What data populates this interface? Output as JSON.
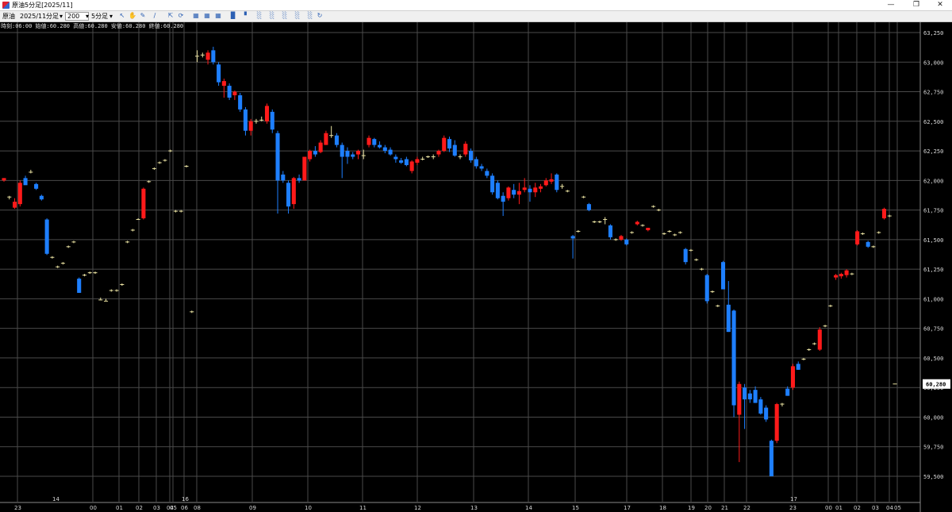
{
  "window": {
    "title": "原油5分足[2025/11]",
    "minimize_icon": "minimize-icon",
    "restore_icon": "restore-icon",
    "close_icon": "close-icon"
  },
  "toolbar": {
    "symbol": "原油",
    "month": "2025/11",
    "period_type": "分足",
    "count": "200",
    "interval": "5分足",
    "icons": [
      "cursor-icon",
      "hand-icon",
      "pencil-icon",
      "line-tool-icon",
      "zoom-icon",
      "refresh-icon",
      "grid-icon",
      "table-icon",
      "indicator-icon",
      "candlestick-icon",
      "bar-chart-icon",
      "bar-chart-2-icon",
      "bar-chart-3-icon",
      "bar-chart-4-icon",
      "bar-chart-5-icon",
      "bar-chart-6-icon",
      "sync-icon"
    ]
  },
  "info_line": "時刻:06:00 始値:60.280 高値:60.280 安値:60.280 終値:60.280",
  "colors": {
    "up": "#ff1a1a",
    "down": "#1e7fff",
    "grid": "#4a4a4a",
    "background": "#000000",
    "last_price_box": "#ffffff"
  },
  "chart_data": {
    "type": "candlestick",
    "title": "",
    "xlabel": "",
    "ylabel": "",
    "ylim": [
      59.35,
      63.3
    ],
    "y_ticks": [
      "63,250",
      "63,000",
      "62,750",
      "62,500",
      "62,250",
      "62,000",
      "61,750",
      "61,500",
      "61,250",
      "61,000",
      "60,750",
      "60,500",
      "60,250",
      "60,000",
      "59,750",
      "59,500"
    ],
    "y_tick_values": [
      63.25,
      63.0,
      62.75,
      62.5,
      62.25,
      62.0,
      61.75,
      61.5,
      61.25,
      61.0,
      60.75,
      60.5,
      60.25,
      60.0,
      59.75,
      59.5
    ],
    "last_price": "60,280",
    "last_price_value": 60.28,
    "x_date_labels": [
      "14",
      "16",
      "17"
    ],
    "x_hour_labels": [
      "23",
      "00",
      "01",
      "02",
      "03",
      "04",
      "05",
      "06",
      "08",
      "09",
      "10",
      "11",
      "12",
      "13",
      "14",
      "15",
      "17",
      "18",
      "19",
      "20",
      "21",
      "22",
      "23",
      "00",
      "01",
      "02",
      "03",
      "04",
      "05",
      "06"
    ],
    "candles": [
      {
        "o": 62.0,
        "h": 62.02,
        "l": 61.99,
        "c": 62.02
      },
      {
        "o": 61.85,
        "h": 61.87,
        "l": 61.84,
        "c": 61.86
      },
      {
        "o": 61.77,
        "h": 61.85,
        "l": 61.76,
        "c": 61.82
      },
      {
        "o": 61.8,
        "h": 62.0,
        "l": 61.78,
        "c": 61.98
      },
      {
        "o": 62.02,
        "h": 62.04,
        "l": 62.0,
        "c": 61.96
      },
      {
        "o": 62.07,
        "h": 62.09,
        "l": 62.06,
        "c": 62.07
      },
      {
        "o": 61.97,
        "h": 61.98,
        "l": 61.92,
        "c": 61.93
      },
      {
        "o": 61.87,
        "h": 61.88,
        "l": 61.83,
        "c": 61.84
      },
      {
        "o": 61.67,
        "h": 61.68,
        "l": 61.37,
        "c": 61.38
      },
      {
        "o": 61.35,
        "h": 61.36,
        "l": 61.34,
        "c": 61.35
      },
      {
        "o": 61.27,
        "h": 61.28,
        "l": 61.26,
        "c": 61.27
      },
      {
        "o": 61.3,
        "h": 61.31,
        "l": 61.29,
        "c": 61.3
      },
      {
        "o": 61.44,
        "h": 61.45,
        "l": 61.43,
        "c": 61.44
      },
      {
        "o": 61.48,
        "h": 61.49,
        "l": 61.47,
        "c": 61.48
      },
      {
        "o": 61.17,
        "h": 61.18,
        "l": 61.05,
        "c": 61.05
      },
      {
        "o": 61.2,
        "h": 61.21,
        "l": 61.19,
        "c": 61.2
      },
      {
        "o": 61.22,
        "h": 61.23,
        "l": 61.21,
        "c": 61.22
      },
      {
        "o": 61.22,
        "h": 61.23,
        "l": 61.21,
        "c": 61.22
      },
      {
        "o": 61.0,
        "h": 61.01,
        "l": 60.99,
        "c": 60.99
      },
      {
        "o": 60.99,
        "h": 61.0,
        "l": 60.98,
        "c": 60.98
      },
      {
        "o": 61.07,
        "h": 61.08,
        "l": 61.06,
        "c": 61.07
      },
      {
        "o": 61.07,
        "h": 61.08,
        "l": 61.06,
        "c": 61.07
      },
      {
        "o": 61.12,
        "h": 61.13,
        "l": 61.11,
        "c": 61.12
      },
      {
        "o": 61.48,
        "h": 61.49,
        "l": 61.47,
        "c": 61.48
      },
      {
        "o": 61.58,
        "h": 61.59,
        "l": 61.57,
        "c": 61.58
      },
      {
        "o": 61.67,
        "h": 61.68,
        "l": 61.67,
        "c": 61.67
      },
      {
        "o": 61.68,
        "h": 61.94,
        "l": 61.67,
        "c": 61.93
      },
      {
        "o": 61.99,
        "h": 62.0,
        "l": 61.98,
        "c": 61.99
      },
      {
        "o": 62.1,
        "h": 62.11,
        "l": 62.09,
        "c": 62.1
      },
      {
        "o": 62.15,
        "h": 62.16,
        "l": 62.14,
        "c": 62.15
      },
      {
        "o": 62.17,
        "h": 62.18,
        "l": 62.16,
        "c": 62.17
      },
      {
        "o": 62.25,
        "h": 62.26,
        "l": 62.24,
        "c": 62.25
      },
      {
        "o": 61.74,
        "h": 61.75,
        "l": 61.73,
        "c": 61.74
      },
      {
        "o": 61.74,
        "h": 61.75,
        "l": 61.73,
        "c": 61.74
      },
      {
        "o": 62.12,
        "h": 62.13,
        "l": 62.11,
        "c": 62.12
      },
      {
        "o": 60.89,
        "h": 60.9,
        "l": 60.88,
        "c": 60.89
      },
      {
        "o": 63.05,
        "h": 63.1,
        "l": 63.0,
        "c": 63.05
      },
      {
        "o": 63.06,
        "h": 63.08,
        "l": 63.04,
        "c": 63.06
      },
      {
        "o": 63.02,
        "h": 63.1,
        "l": 62.98,
        "c": 63.08
      },
      {
        "o": 63.1,
        "h": 63.13,
        "l": 62.98,
        "c": 63.0
      },
      {
        "o": 62.98,
        "h": 63.0,
        "l": 62.8,
        "c": 62.83
      },
      {
        "o": 62.8,
        "h": 62.86,
        "l": 62.7,
        "c": 62.84
      },
      {
        "o": 62.8,
        "h": 62.82,
        "l": 62.68,
        "c": 62.7
      },
      {
        "o": 62.72,
        "h": 62.76,
        "l": 62.68,
        "c": 62.75
      },
      {
        "o": 62.72,
        "h": 62.74,
        "l": 62.58,
        "c": 62.6
      },
      {
        "o": 62.6,
        "h": 62.62,
        "l": 62.38,
        "c": 62.42
      },
      {
        "o": 62.42,
        "h": 62.52,
        "l": 62.38,
        "c": 62.5
      },
      {
        "o": 62.5,
        "h": 62.52,
        "l": 62.48,
        "c": 62.5
      },
      {
        "o": 62.52,
        "h": 62.54,
        "l": 62.5,
        "c": 62.51
      },
      {
        "o": 62.5,
        "h": 62.65,
        "l": 62.48,
        "c": 62.63
      },
      {
        "o": 62.58,
        "h": 62.6,
        "l": 62.4,
        "c": 62.43
      },
      {
        "o": 62.4,
        "h": 62.42,
        "l": 61.72,
        "c": 62.0
      },
      {
        "o": 62.05,
        "h": 62.08,
        "l": 61.98,
        "c": 62.0
      },
      {
        "o": 61.98,
        "h": 62.0,
        "l": 61.72,
        "c": 61.78
      },
      {
        "o": 61.8,
        "h": 62.03,
        "l": 61.76,
        "c": 62.02
      },
      {
        "o": 62.02,
        "h": 62.05,
        "l": 61.98,
        "c": 62.0
      },
      {
        "o": 62.0,
        "h": 62.2,
        "l": 62.0,
        "c": 62.2
      },
      {
        "o": 62.18,
        "h": 62.26,
        "l": 62.16,
        "c": 62.25
      },
      {
        "o": 62.25,
        "h": 62.29,
        "l": 62.2,
        "c": 62.22
      },
      {
        "o": 62.24,
        "h": 62.34,
        "l": 62.23,
        "c": 62.32
      },
      {
        "o": 62.3,
        "h": 62.42,
        "l": 62.3,
        "c": 62.4
      },
      {
        "o": 62.38,
        "h": 62.46,
        "l": 62.36,
        "c": 62.38
      },
      {
        "o": 62.38,
        "h": 62.4,
        "l": 62.28,
        "c": 62.3
      },
      {
        "o": 62.3,
        "h": 62.32,
        "l": 62.02,
        "c": 62.2
      },
      {
        "o": 62.25,
        "h": 62.28,
        "l": 62.14,
        "c": 62.2
      },
      {
        "o": 62.22,
        "h": 62.24,
        "l": 62.18,
        "c": 62.2
      },
      {
        "o": 62.22,
        "h": 62.26,
        "l": 62.18,
        "c": 62.25
      },
      {
        "o": 62.22,
        "h": 62.26,
        "l": 62.18,
        "c": 62.21
      },
      {
        "o": 62.3,
        "h": 62.38,
        "l": 62.28,
        "c": 62.36
      },
      {
        "o": 62.35,
        "h": 62.36,
        "l": 62.28,
        "c": 62.3
      },
      {
        "o": 62.3,
        "h": 62.33,
        "l": 62.27,
        "c": 62.28
      },
      {
        "o": 62.28,
        "h": 62.3,
        "l": 62.23,
        "c": 62.25
      },
      {
        "o": 62.26,
        "h": 62.28,
        "l": 62.21,
        "c": 62.22
      },
      {
        "o": 62.2,
        "h": 62.22,
        "l": 62.15,
        "c": 62.18
      },
      {
        "o": 62.17,
        "h": 62.19,
        "l": 62.14,
        "c": 62.15
      },
      {
        "o": 62.18,
        "h": 62.2,
        "l": 62.12,
        "c": 62.13
      },
      {
        "o": 62.08,
        "h": 62.17,
        "l": 62.06,
        "c": 62.16
      },
      {
        "o": 62.15,
        "h": 62.2,
        "l": 62.13,
        "c": 62.18
      },
      {
        "o": 62.18,
        "h": 62.2,
        "l": 62.17,
        "c": 62.18
      },
      {
        "o": 62.2,
        "h": 62.21,
        "l": 62.19,
        "c": 62.2
      },
      {
        "o": 62.2,
        "h": 62.22,
        "l": 62.18,
        "c": 62.2
      },
      {
        "o": 62.22,
        "h": 62.26,
        "l": 62.2,
        "c": 62.25
      },
      {
        "o": 62.25,
        "h": 62.38,
        "l": 62.24,
        "c": 62.36
      },
      {
        "o": 62.35,
        "h": 62.37,
        "l": 62.24,
        "c": 62.27
      },
      {
        "o": 62.3,
        "h": 62.34,
        "l": 62.2,
        "c": 62.21
      },
      {
        "o": 62.2,
        "h": 62.22,
        "l": 62.18,
        "c": 62.2
      },
      {
        "o": 62.22,
        "h": 62.33,
        "l": 62.2,
        "c": 62.31
      },
      {
        "o": 62.25,
        "h": 62.27,
        "l": 62.15,
        "c": 62.17
      },
      {
        "o": 62.18,
        "h": 62.2,
        "l": 62.1,
        "c": 62.12
      },
      {
        "o": 62.12,
        "h": 62.14,
        "l": 62.08,
        "c": 62.1
      },
      {
        "o": 62.08,
        "h": 62.1,
        "l": 62.02,
        "c": 62.04
      },
      {
        "o": 62.04,
        "h": 62.06,
        "l": 61.88,
        "c": 61.9
      },
      {
        "o": 61.98,
        "h": 62.0,
        "l": 61.84,
        "c": 61.85
      },
      {
        "o": 61.87,
        "h": 61.9,
        "l": 61.7,
        "c": 61.82
      },
      {
        "o": 61.85,
        "h": 61.95,
        "l": 61.83,
        "c": 61.94
      },
      {
        "o": 61.92,
        "h": 61.97,
        "l": 61.85,
        "c": 61.88
      },
      {
        "o": 61.88,
        "h": 61.98,
        "l": 61.8,
        "c": 61.91
      },
      {
        "o": 61.92,
        "h": 62.02,
        "l": 61.9,
        "c": 61.94
      },
      {
        "o": 61.93,
        "h": 61.96,
        "l": 61.82,
        "c": 61.9
      },
      {
        "o": 61.9,
        "h": 61.98,
        "l": 61.86,
        "c": 61.94
      },
      {
        "o": 61.93,
        "h": 61.97,
        "l": 61.9,
        "c": 61.95
      },
      {
        "o": 61.96,
        "h": 62.02,
        "l": 61.95,
        "c": 62.0
      },
      {
        "o": 61.99,
        "h": 62.06,
        "l": 61.97,
        "c": 62.01
      },
      {
        "o": 62.05,
        "h": 62.06,
        "l": 61.9,
        "c": 61.92
      },
      {
        "o": 61.95,
        "h": 61.97,
        "l": 61.93,
        "c": 61.95
      },
      {
        "o": 61.91,
        "h": 61.92,
        "l": 61.9,
        "c": 61.91
      },
      {
        "o": 61.53,
        "h": 61.54,
        "l": 61.34,
        "c": 61.51
      },
      {
        "o": 61.57,
        "h": 61.58,
        "l": 61.56,
        "c": 61.57
      },
      {
        "o": 61.86,
        "h": 61.87,
        "l": 61.85,
        "c": 61.86
      },
      {
        "o": 61.8,
        "h": 61.81,
        "l": 61.74,
        "c": 61.75
      },
      {
        "o": 61.65,
        "h": 61.66,
        "l": 61.64,
        "c": 61.65
      },
      {
        "o": 61.65,
        "h": 61.66,
        "l": 61.64,
        "c": 61.65
      },
      {
        "o": 61.68,
        "h": 61.69,
        "l": 61.63,
        "c": 61.67
      },
      {
        "o": 61.62,
        "h": 61.63,
        "l": 61.5,
        "c": 61.52
      },
      {
        "o": 61.5,
        "h": 61.51,
        "l": 61.49,
        "c": 61.5
      },
      {
        "o": 61.5,
        "h": 61.54,
        "l": 61.49,
        "c": 61.53
      },
      {
        "o": 61.5,
        "h": 61.51,
        "l": 61.45,
        "c": 61.46
      },
      {
        "o": 61.56,
        "h": 61.57,
        "l": 61.55,
        "c": 61.56
      },
      {
        "o": 61.63,
        "h": 61.66,
        "l": 61.62,
        "c": 61.65
      },
      {
        "o": 61.62,
        "h": 61.63,
        "l": 61.61,
        "c": 61.62
      },
      {
        "o": 61.58,
        "h": 61.6,
        "l": 61.57,
        "c": 61.6
      },
      {
        "o": 61.78,
        "h": 61.79,
        "l": 61.77,
        "c": 61.78
      },
      {
        "o": 61.75,
        "h": 61.76,
        "l": 61.74,
        "c": 61.75
      },
      {
        "o": 61.55,
        "h": 61.56,
        "l": 61.54,
        "c": 61.55
      },
      {
        "o": 61.57,
        "h": 61.58,
        "l": 61.56,
        "c": 61.57
      },
      {
        "o": 61.54,
        "h": 61.55,
        "l": 61.53,
        "c": 61.54
      },
      {
        "o": 61.56,
        "h": 61.57,
        "l": 61.55,
        "c": 61.56
      },
      {
        "o": 61.42,
        "h": 61.43,
        "l": 61.29,
        "c": 61.31
      },
      {
        "o": 61.41,
        "h": 61.42,
        "l": 61.4,
        "c": 61.41
      },
      {
        "o": 61.33,
        "h": 61.34,
        "l": 61.32,
        "c": 61.33
      },
      {
        "o": 61.25,
        "h": 61.26,
        "l": 61.24,
        "c": 61.25
      },
      {
        "o": 61.2,
        "h": 61.21,
        "l": 60.96,
        "c": 60.98
      },
      {
        "o": 61.06,
        "h": 61.07,
        "l": 61.05,
        "c": 61.06
      },
      {
        "o": 60.94,
        "h": 60.95,
        "l": 60.93,
        "c": 60.94
      },
      {
        "o": 61.31,
        "h": 61.32,
        "l": 61.08,
        "c": 61.08
      },
      {
        "o": 60.95,
        "h": 61.15,
        "l": 60.72,
        "c": 60.72
      },
      {
        "o": 60.9,
        "h": 60.91,
        "l": 60.0,
        "c": 60.1
      },
      {
        "o": 60.02,
        "h": 60.3,
        "l": 59.62,
        "c": 60.28
      },
      {
        "o": 60.25,
        "h": 60.28,
        "l": 59.9,
        "c": 60.15
      },
      {
        "o": 60.2,
        "h": 60.23,
        "l": 60.12,
        "c": 60.15
      },
      {
        "o": 60.23,
        "h": 60.26,
        "l": 60.12,
        "c": 60.12
      },
      {
        "o": 60.15,
        "h": 60.17,
        "l": 60.02,
        "c": 60.03
      },
      {
        "o": 60.08,
        "h": 60.1,
        "l": 59.96,
        "c": 59.98
      },
      {
        "o": 59.8,
        "h": 59.81,
        "l": 59.5,
        "c": 59.5
      },
      {
        "o": 59.8,
        "h": 60.12,
        "l": 59.78,
        "c": 60.11
      },
      {
        "o": 60.1,
        "h": 60.12,
        "l": 60.09,
        "c": 60.11
      },
      {
        "o": 60.24,
        "h": 60.26,
        "l": 60.18,
        "c": 60.18
      },
      {
        "o": 60.25,
        "h": 60.45,
        "l": 60.23,
        "c": 60.43
      },
      {
        "o": 60.45,
        "h": 60.47,
        "l": 60.4,
        "c": 60.4
      },
      {
        "o": 60.49,
        "h": 60.5,
        "l": 60.48,
        "c": 60.49
      },
      {
        "o": 60.57,
        "h": 60.58,
        "l": 60.56,
        "c": 60.57
      },
      {
        "o": 60.62,
        "h": 60.63,
        "l": 60.61,
        "c": 60.62
      },
      {
        "o": 60.57,
        "h": 60.76,
        "l": 60.56,
        "c": 60.74
      },
      {
        "o": 60.77,
        "h": 60.78,
        "l": 60.76,
        "c": 60.77
      },
      {
        "o": 60.94,
        "h": 60.95,
        "l": 60.93,
        "c": 60.94
      },
      {
        "o": 61.18,
        "h": 61.21,
        "l": 61.16,
        "c": 61.2
      },
      {
        "o": 61.19,
        "h": 61.22,
        "l": 61.17,
        "c": 61.21
      },
      {
        "o": 61.2,
        "h": 61.25,
        "l": 61.18,
        "c": 61.24
      },
      {
        "o": 61.21,
        "h": 61.22,
        "l": 61.2,
        "c": 61.21
      },
      {
        "o": 61.46,
        "h": 61.58,
        "l": 61.45,
        "c": 61.57
      },
      {
        "o": 61.55,
        "h": 61.56,
        "l": 61.54,
        "c": 61.55
      },
      {
        "o": 61.48,
        "h": 61.49,
        "l": 61.43,
        "c": 61.44
      },
      {
        "o": 61.44,
        "h": 61.45,
        "l": 61.43,
        "c": 61.44
      },
      {
        "o": 61.56,
        "h": 61.57,
        "l": 61.55,
        "c": 61.56
      },
      {
        "o": 61.68,
        "h": 61.77,
        "l": 61.67,
        "c": 61.76
      },
      {
        "o": 61.7,
        "h": 61.71,
        "l": 61.69,
        "c": 61.7
      },
      {
        "o": 60.28,
        "h": 60.28,
        "l": 60.28,
        "c": 60.28
      }
    ]
  }
}
